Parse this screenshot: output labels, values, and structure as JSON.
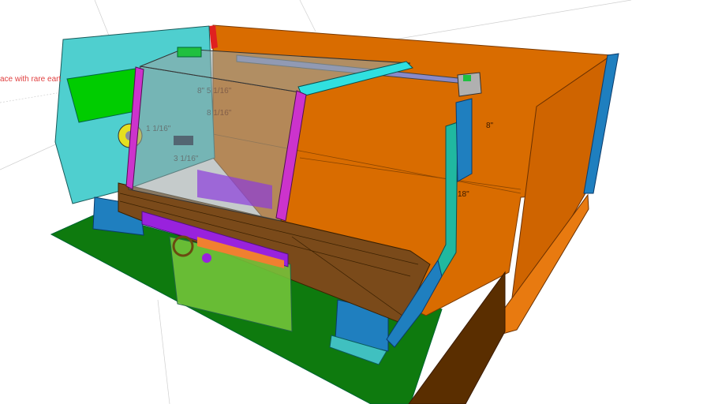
{
  "scene": {
    "note_text": "ace with rare eart",
    "dimensions": [
      "8\"",
      "18\"",
      "8\" 5 1/16\"",
      "8 1/16\"",
      "1 1/16\"",
      "3 1/16\""
    ],
    "colors": {
      "enclosure": "#d96c00",
      "door": "#4fcfcf",
      "ground": "#0e7a0e",
      "panel": "#00cc00",
      "guard_frame": "#cc33cc",
      "bed": "#7a4a1a",
      "pillar": "#1f7fbf",
      "accent_red": "#e02020"
    }
  }
}
